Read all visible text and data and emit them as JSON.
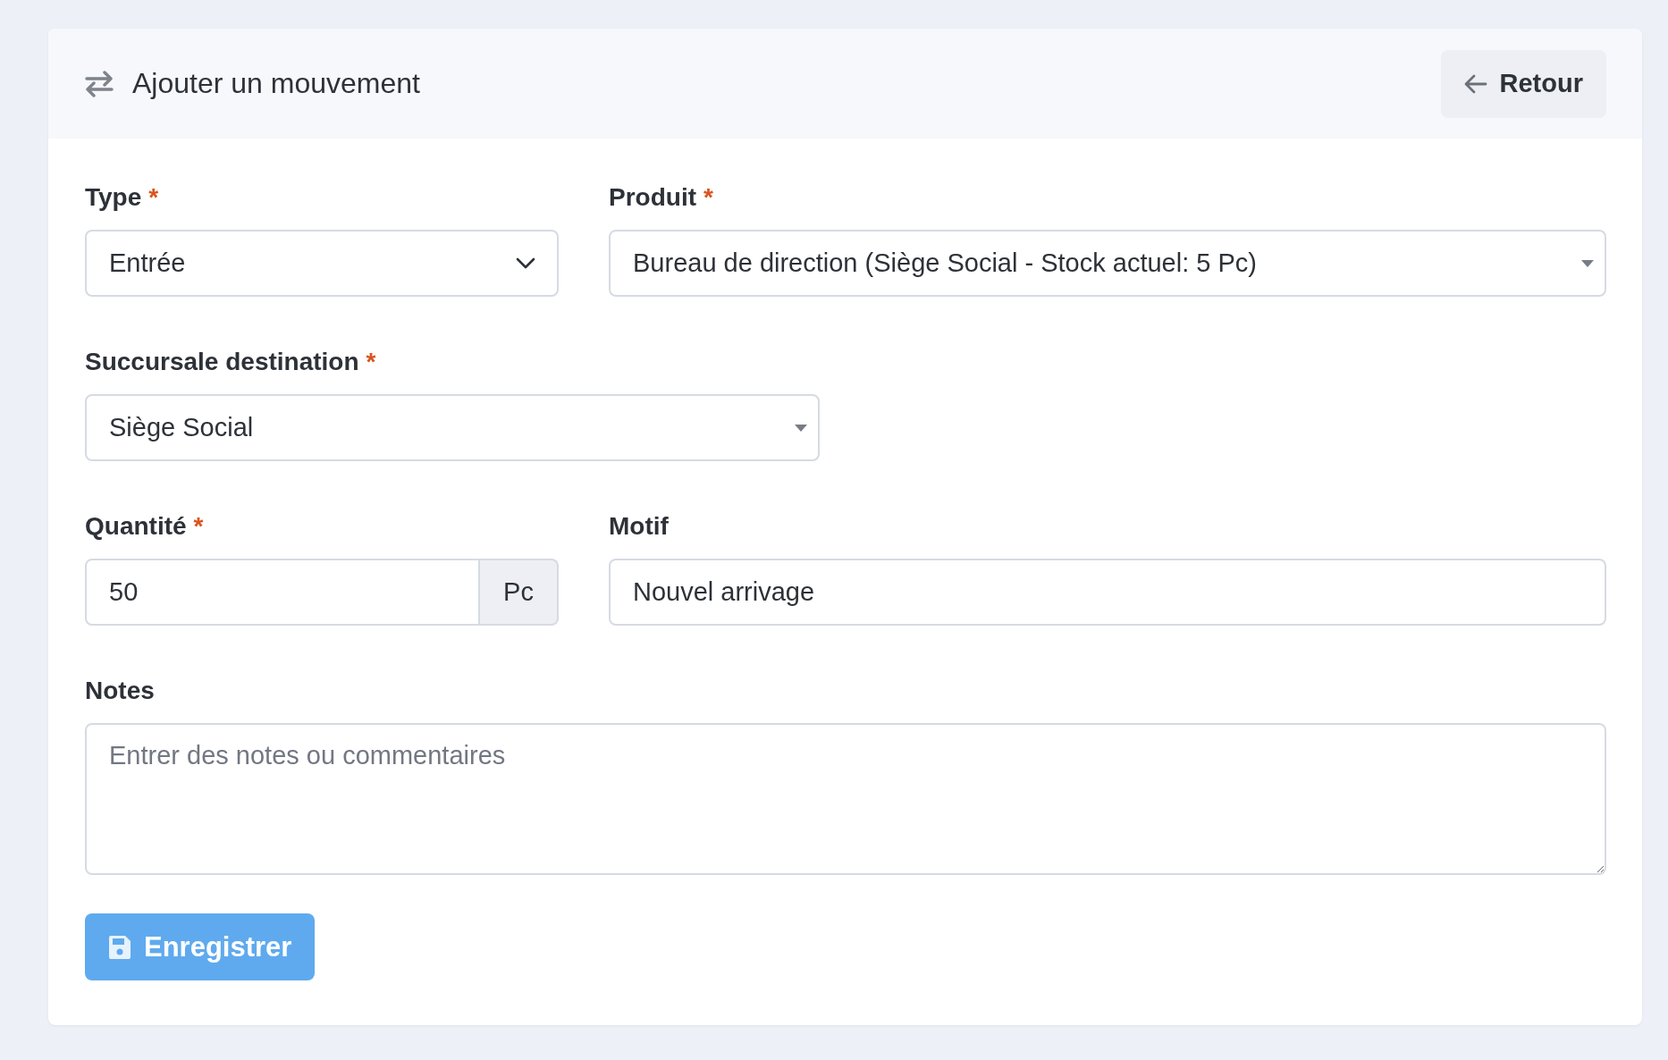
{
  "header": {
    "title": "Ajouter un mouvement",
    "back_button": "Retour"
  },
  "fields": {
    "type": {
      "label": "Type",
      "required": true,
      "value": "Entrée"
    },
    "product": {
      "label": "Produit",
      "required": true,
      "value": "Bureau de direction (Siège Social - Stock actuel: 5 Pc)"
    },
    "branch": {
      "label": "Succursale destination",
      "required": true,
      "value": "Siège Social"
    },
    "quantity": {
      "label": "Quantité",
      "required": true,
      "value": "50",
      "unit": "Pc"
    },
    "reason": {
      "label": "Motif",
      "required": false,
      "value": "Nouvel arrivage"
    },
    "notes": {
      "label": "Notes",
      "required": false,
      "placeholder": "Entrer des notes ou commentaires"
    }
  },
  "required_mark": "*",
  "save_button": "Enregistrer"
}
